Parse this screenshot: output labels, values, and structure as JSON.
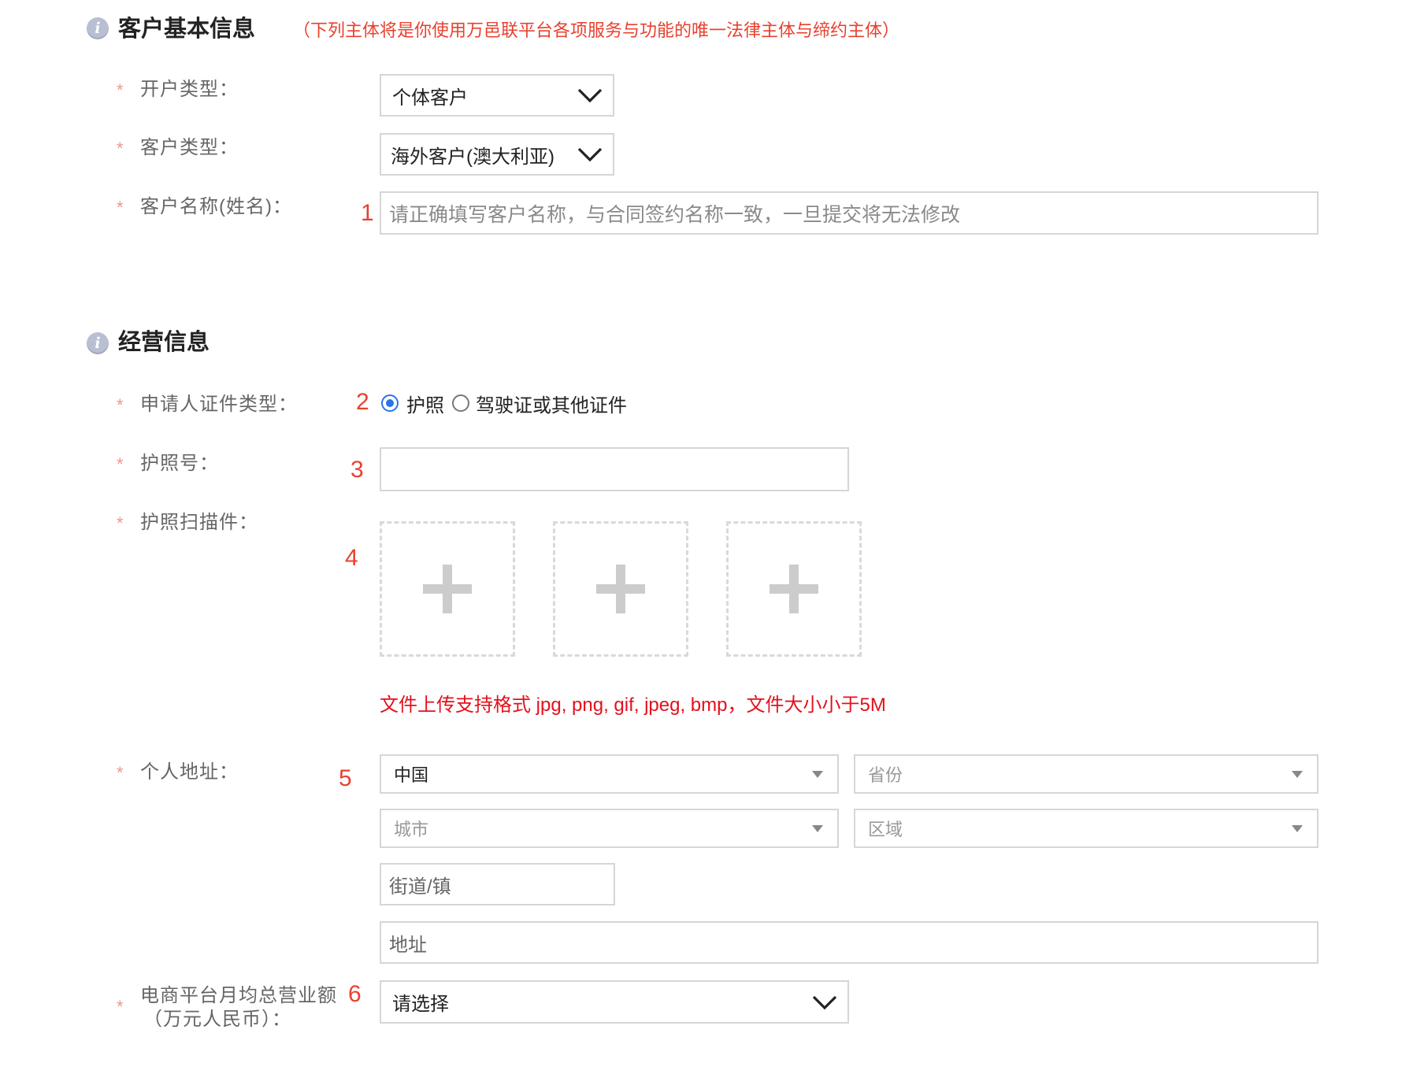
{
  "section_basic": {
    "title": "客户基本信息",
    "note": "（下列主体将是你使用万邑联平台各项服务与功能的唯一法律主体与缔约主体）",
    "icon": "info-icon"
  },
  "required_mark": "*",
  "fields": {
    "account_type": {
      "label": "开户类型：",
      "value": "个体客户"
    },
    "customer_type": {
      "label": "客户类型：",
      "value": "海外客户(澳大利亚)"
    },
    "customer_name": {
      "label": "客户名称(姓名)：",
      "marker": "1",
      "placeholder": "请正确填写客户名称，与合同签约名称一致，一旦提交将无法修改"
    }
  },
  "section_business": {
    "title": "经营信息",
    "icon": "info-icon"
  },
  "business": {
    "id_type": {
      "label": "申请人证件类型：",
      "marker": "2",
      "options": [
        "护照",
        "驾驶证或其他证件"
      ],
      "selected": "护照"
    },
    "passport_no": {
      "label": "护照号：",
      "marker": "3",
      "value": ""
    },
    "passport_scan": {
      "label": "护照扫描件：",
      "marker": "4",
      "upload_slots": 3,
      "hint": "文件上传支持格式 jpg, png, gif, jpeg, bmp，文件大小小于5M"
    },
    "address": {
      "label": "个人地址：",
      "marker": "5",
      "country": "中国",
      "province": "省份",
      "city": "城市",
      "district": "区域",
      "street": "街道/镇",
      "detail": "地址"
    },
    "turnover": {
      "label_line1": "电商平台月均总营业额",
      "label_line2": "（万元人民币）：",
      "marker": "6",
      "value": "请选择"
    }
  },
  "colors": {
    "accent_red": "#e8412f",
    "hint_red": "#e4101c",
    "radio_blue": "#2a73e8",
    "border": "#d6d6d6"
  }
}
